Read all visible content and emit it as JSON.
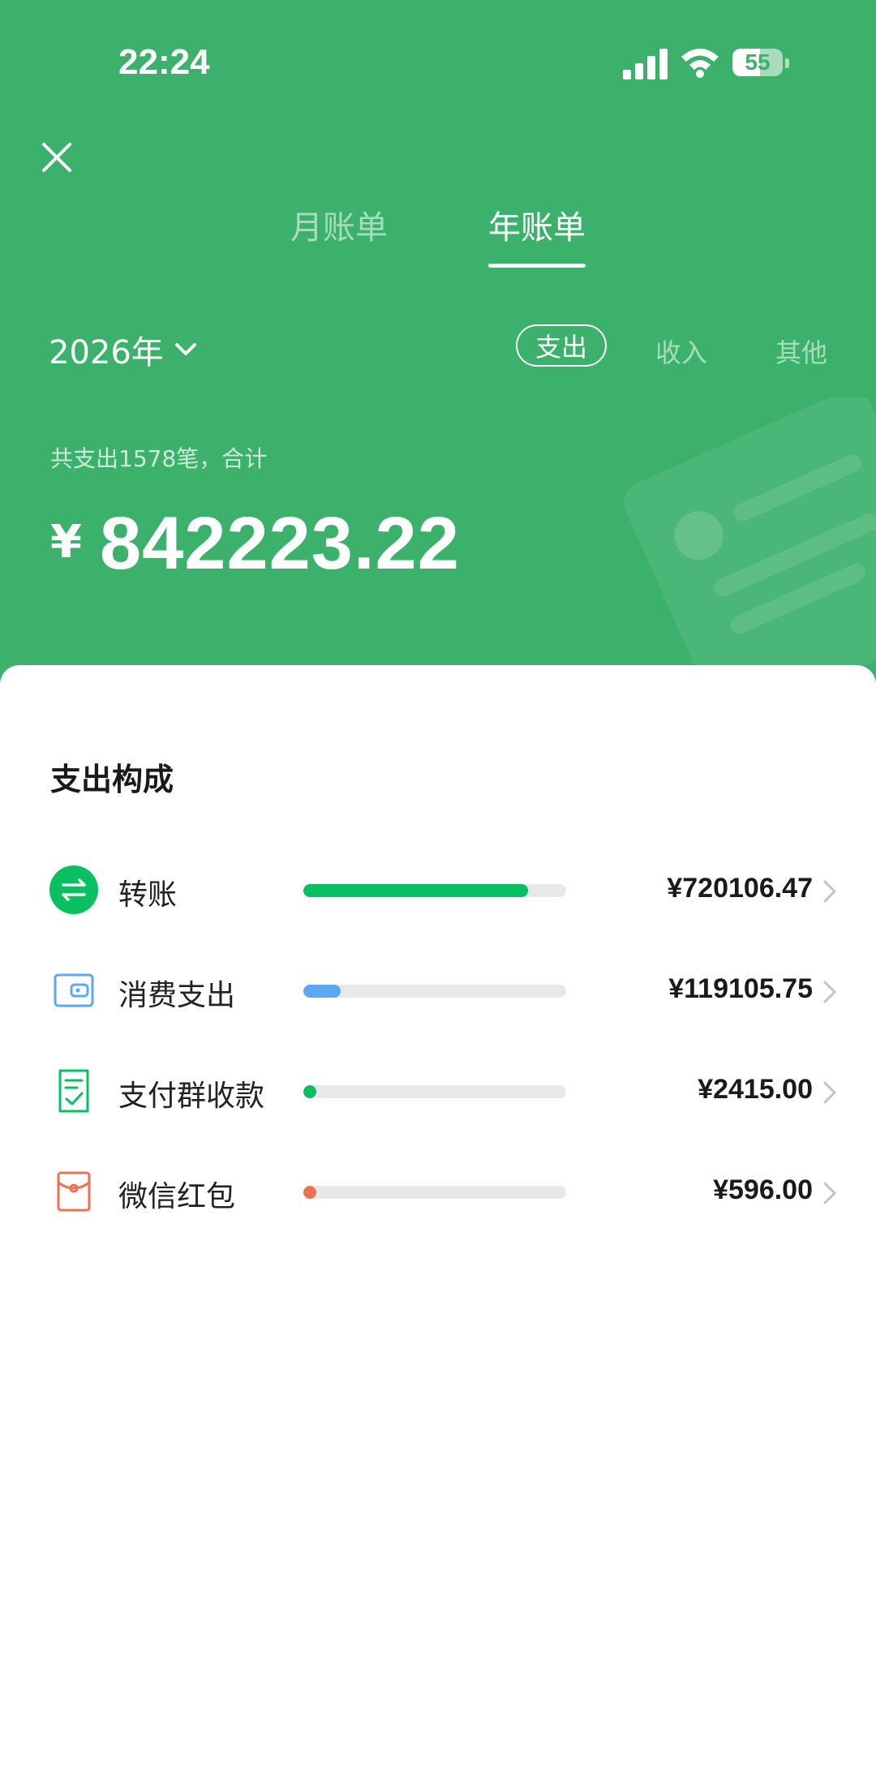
{
  "status_bar": {
    "time": "22:24",
    "battery": "55",
    "battery_level": 0.55
  },
  "tabs": [
    {
      "label": "月账单"
    },
    {
      "label": "年账单"
    }
  ],
  "year_select": {
    "label": "2026年"
  },
  "filters": [
    {
      "label": "支出"
    },
    {
      "label": "收入"
    },
    {
      "label": "其他"
    }
  ],
  "summary": {
    "text": "共支出1578笔，合计",
    "currency": "¥",
    "total": "842223.22"
  },
  "breakdown": {
    "title": "支出构成",
    "items": [
      {
        "name": "转账",
        "amount": "¥720106.47",
        "share": 0.855,
        "color": "#07c160",
        "icon": "transfer-icon"
      },
      {
        "name": "消费支出",
        "amount": "¥119105.75",
        "share": 0.141,
        "color": "#5ba8f5",
        "icon": "wallet-icon"
      },
      {
        "name": "支付群收款",
        "amount": "¥2415.00",
        "share": 0.003,
        "color": "#07c160",
        "icon": "group-receipt-icon"
      },
      {
        "name": "微信红包",
        "amount": "¥596.00",
        "share": 0.001,
        "color": "#f07052",
        "icon": "red-packet-icon"
      }
    ]
  },
  "colors": {
    "header_bg": "#3cb16c",
    "accent": "#07c160"
  }
}
